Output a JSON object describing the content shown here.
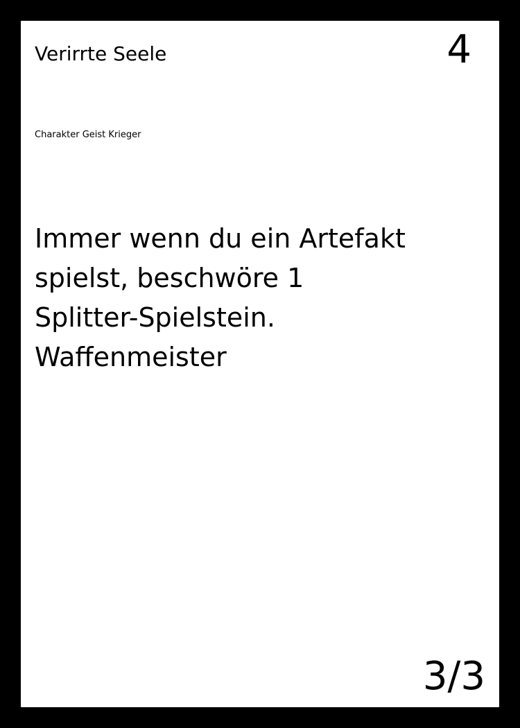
{
  "card": {
    "name": "Verirrte Seele",
    "cost": "4",
    "type_line": "Charakter Geist Krieger",
    "text_lines": [
      "Immer wenn du ein Artefakt",
      "spielst, beschwöre 1",
      "Splitter-Spielstein.",
      "Waffenmeister"
    ],
    "stats": "3/3"
  },
  "colors": {
    "border": "#000000",
    "card_face": "#ffffff",
    "text": "#000000"
  }
}
